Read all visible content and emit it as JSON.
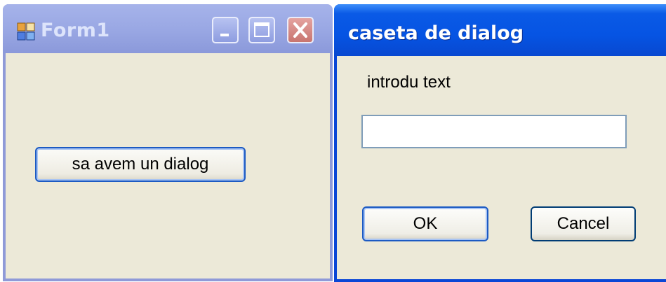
{
  "form1": {
    "title": "Form1",
    "button_label": "sa avem un dialog"
  },
  "dialog": {
    "title": "caseta de dialog",
    "prompt": "introdu text",
    "input_value": "",
    "ok_label": "OK",
    "cancel_label": "Cancel"
  },
  "icons": {
    "app": "app-icon",
    "minimize": "minimize-icon",
    "maximize": "maximize-icon",
    "close": "close-icon"
  },
  "colors": {
    "inactive_titlebar": "#9aa8e4",
    "active_titlebar": "#0654e3",
    "window_background": "#ece9d8",
    "close_button": "#c87570"
  }
}
